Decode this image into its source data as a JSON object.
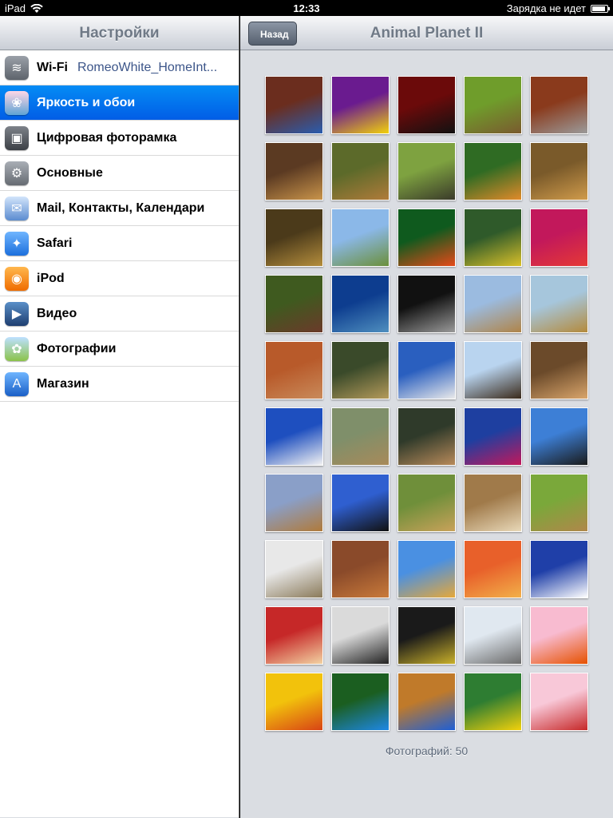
{
  "status_bar": {
    "device": "iPad",
    "time": "12:33",
    "battery_text": "Зарядка не идет",
    "battery_level": 0.9
  },
  "left_panel": {
    "title": "Настройки",
    "items": [
      {
        "label": "Wi-Fi",
        "value": "RomeoWhite_HomeInt...",
        "icon": "wifi-icon",
        "selected": false
      },
      {
        "label": "Яркость и обои",
        "icon": "brightness-icon",
        "selected": true
      },
      {
        "label": "Цифровая фоторамка",
        "icon": "picture-frame-icon",
        "selected": false
      },
      {
        "label": "Основные",
        "icon": "gear-icon",
        "selected": false
      },
      {
        "label": "Mail, Контакты, Календари",
        "icon": "mail-icon",
        "selected": false
      },
      {
        "label": "Safari",
        "icon": "compass-icon",
        "selected": false
      },
      {
        "label": "iPod",
        "icon": "ipod-icon",
        "selected": false
      },
      {
        "label": "Видео",
        "icon": "video-icon",
        "selected": false
      },
      {
        "label": "Фотографии",
        "icon": "sunflower-icon",
        "selected": false
      },
      {
        "label": "Магазин",
        "icon": "app-store-icon",
        "selected": false
      }
    ]
  },
  "right_panel": {
    "back_label": "Назад",
    "title": "Animal Planet II",
    "photo_count_label": "Фотографий: 50",
    "photos": [
      {
        "subject": "bluebird",
        "colors": [
          "#6b2d1e",
          "#2a5db0"
        ]
      },
      {
        "subject": "goldfinch",
        "colors": [
          "#6a1b8f",
          "#f2d10c"
        ]
      },
      {
        "subject": "black-panther",
        "colors": [
          "#6b0a0a",
          "#111111"
        ]
      },
      {
        "subject": "groundhog",
        "colors": [
          "#6f9d2b",
          "#7a5a2f"
        ]
      },
      {
        "subject": "wolf",
        "colors": [
          "#8a3a1c",
          "#9b9b9b"
        ]
      },
      {
        "subject": "lion-cub",
        "colors": [
          "#5b3a22",
          "#c9944a"
        ]
      },
      {
        "subject": "lions",
        "colors": [
          "#5c6a2a",
          "#b07b3a"
        ]
      },
      {
        "subject": "turtles",
        "colors": [
          "#7ea240",
          "#3a3a2a"
        ]
      },
      {
        "subject": "tiger",
        "colors": [
          "#2f6b23",
          "#e18a2a"
        ]
      },
      {
        "subject": "lion-family",
        "colors": [
          "#7a5a2a",
          "#d09b4b"
        ]
      },
      {
        "subject": "leopard",
        "colors": [
          "#4b3a1a",
          "#b48d3c"
        ]
      },
      {
        "subject": "rainbow",
        "colors": [
          "#8bb8e8",
          "#6b8f3a"
        ]
      },
      {
        "subject": "tree-frog",
        "colors": [
          "#0f5a1e",
          "#e64a19"
        ]
      },
      {
        "subject": "bird-nest",
        "colors": [
          "#2f5a2a",
          "#d9c02a"
        ]
      },
      {
        "subject": "poison-frog",
        "colors": [
          "#c2185b",
          "#e53935"
        ]
      },
      {
        "subject": "turkey",
        "colors": [
          "#3f5a1f",
          "#6b3a2a"
        ]
      },
      {
        "subject": "sea-turtle",
        "colors": [
          "#0d3d8f",
          "#4f8fbf"
        ]
      },
      {
        "subject": "moon-deer",
        "colors": [
          "#111111",
          "#9a9a9a"
        ]
      },
      {
        "subject": "lion-cubs",
        "colors": [
          "#9bbbe0",
          "#b08448"
        ]
      },
      {
        "subject": "leopard-tree",
        "colors": [
          "#a6c6dc",
          "#b48a3c"
        ]
      },
      {
        "subject": "cougar",
        "colors": [
          "#b85a2a",
          "#c98a5a"
        ]
      },
      {
        "subject": "leopard-rest",
        "colors": [
          "#3a4a2a",
          "#b49a5a"
        ]
      },
      {
        "subject": "eagles-branch",
        "colors": [
          "#2a5fbf",
          "#eaeaea"
        ]
      },
      {
        "subject": "bald-eagles",
        "colors": [
          "#b9d4ef",
          "#3a2a1a"
        ]
      },
      {
        "subject": "cougar-cub",
        "colors": [
          "#6b4a2a",
          "#d9a56b"
        ]
      },
      {
        "subject": "mountain-goats",
        "colors": [
          "#1e4fbf",
          "#f2f2f2"
        ]
      },
      {
        "subject": "prairie-dogs",
        "colors": [
          "#7f8f6a",
          "#a88a5a"
        ]
      },
      {
        "subject": "cubs",
        "colors": [
          "#2f3a2a",
          "#b88a5a"
        ]
      },
      {
        "subject": "hummingbird",
        "colors": [
          "#1e3fa0",
          "#c2185b"
        ]
      },
      {
        "subject": "eagle-flight",
        "colors": [
          "#3d7fd6",
          "#1a1a1a"
        ]
      },
      {
        "subject": "cougar-sky",
        "colors": [
          "#8a9fc8",
          "#b07a3a"
        ]
      },
      {
        "subject": "eagle-wings",
        "colors": [
          "#2f5fd0",
          "#111111"
        ]
      },
      {
        "subject": "cheetah-cubs",
        "colors": [
          "#6f8f3a",
          "#c9a25a"
        ]
      },
      {
        "subject": "owls",
        "colors": [
          "#a07a4a",
          "#e8d8b8"
        ]
      },
      {
        "subject": "meerkats",
        "colors": [
          "#7aa83a",
          "#b0874a"
        ]
      },
      {
        "subject": "snow-leopard",
        "colors": [
          "#e8e8e8",
          "#8a7a5a"
        ]
      },
      {
        "subject": "canyon-cougar",
        "colors": [
          "#8a4a2a",
          "#c97a3a"
        ]
      },
      {
        "subject": "cheetah",
        "colors": [
          "#4a90e2",
          "#e6a83a"
        ]
      },
      {
        "subject": "lion-sunset",
        "colors": [
          "#e8602a",
          "#f2b04a"
        ]
      },
      {
        "subject": "eagle-sea",
        "colors": [
          "#1f3fa8",
          "#ffffff"
        ]
      },
      {
        "subject": "kitten-puppy",
        "colors": [
          "#c62828",
          "#f2d2a2"
        ]
      },
      {
        "subject": "white-tiger",
        "colors": [
          "#dadada",
          "#222222"
        ]
      },
      {
        "subject": "black-panther-eyes",
        "colors": [
          "#1a1a1a",
          "#c9b02a"
        ]
      },
      {
        "subject": "wolves-snow",
        "colors": [
          "#e0e8f0",
          "#6a6a6a"
        ]
      },
      {
        "subject": "butterfly-flowers",
        "colors": [
          "#f8bbd0",
          "#e65100"
        ]
      },
      {
        "subject": "monarch-butterfly",
        "colors": [
          "#f2c20c",
          "#d84315"
        ]
      },
      {
        "subject": "blue-butterfly",
        "colors": [
          "#1b5e20",
          "#1e88e5"
        ]
      },
      {
        "subject": "blue-bird",
        "colors": [
          "#c07a2a",
          "#1e5fd6"
        ]
      },
      {
        "subject": "goldfinch-branch",
        "colors": [
          "#2e7d32",
          "#f2d10c"
        ]
      },
      {
        "subject": "cardinal",
        "colors": [
          "#f8c8d8",
          "#c62828"
        ]
      }
    ]
  }
}
